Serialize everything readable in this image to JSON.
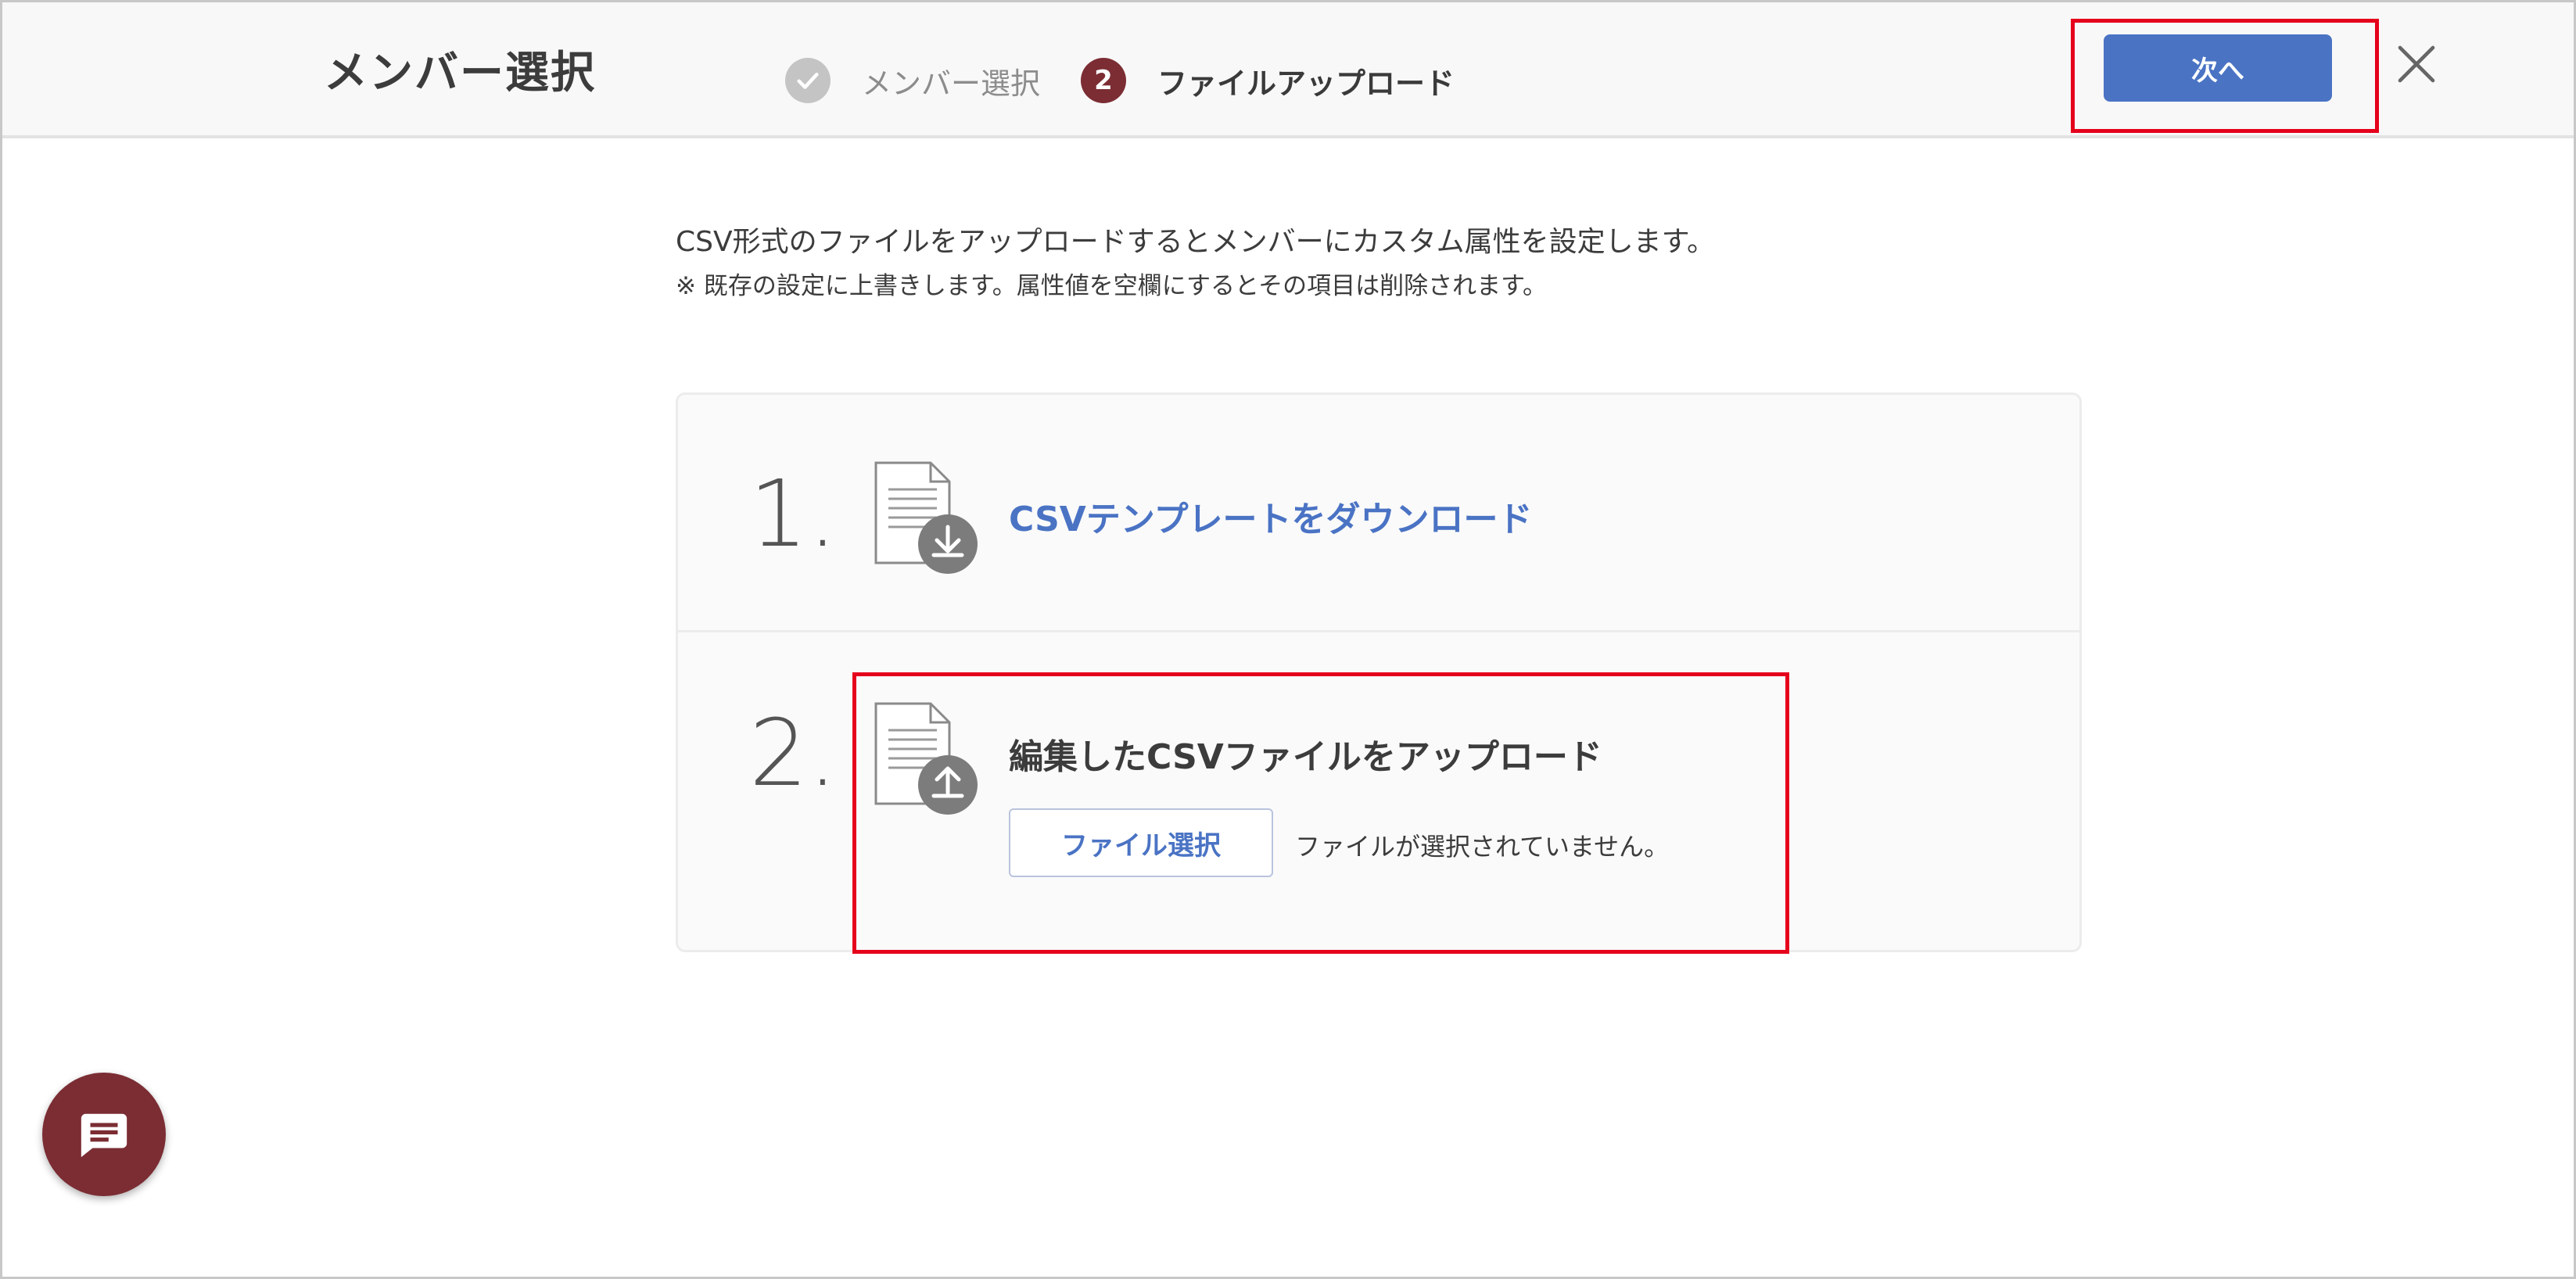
{
  "header": {
    "title": "メンバー選択",
    "steps": [
      {
        "label": "メンバー選択",
        "state": "completed"
      },
      {
        "number": "2",
        "label": "ファイルアップロード",
        "state": "current"
      }
    ],
    "next_label": "次へ"
  },
  "description": {
    "main": "CSV形式のファイルをアップロードするとメンバーにカスタム属性を設定します。",
    "note": "※ 既存の設定に上書きします。属性値を空欄にするとその項目は削除されます。"
  },
  "card": {
    "step1": {
      "number": "1.",
      "link_label": "CSVテンプレートをダウンロード"
    },
    "step2": {
      "number": "2.",
      "title": "編集したCSVファイルをアップロード",
      "file_button_label": "ファイル選択",
      "file_status": "ファイルが選択されていません。"
    }
  },
  "colors": {
    "accent_blue": "#4a73c4",
    "brand_maroon": "#7b2d33",
    "highlight_red": "#e5001c"
  },
  "icons": [
    "check-icon",
    "close-icon",
    "file-download-icon",
    "file-upload-icon",
    "chat-icon"
  ]
}
